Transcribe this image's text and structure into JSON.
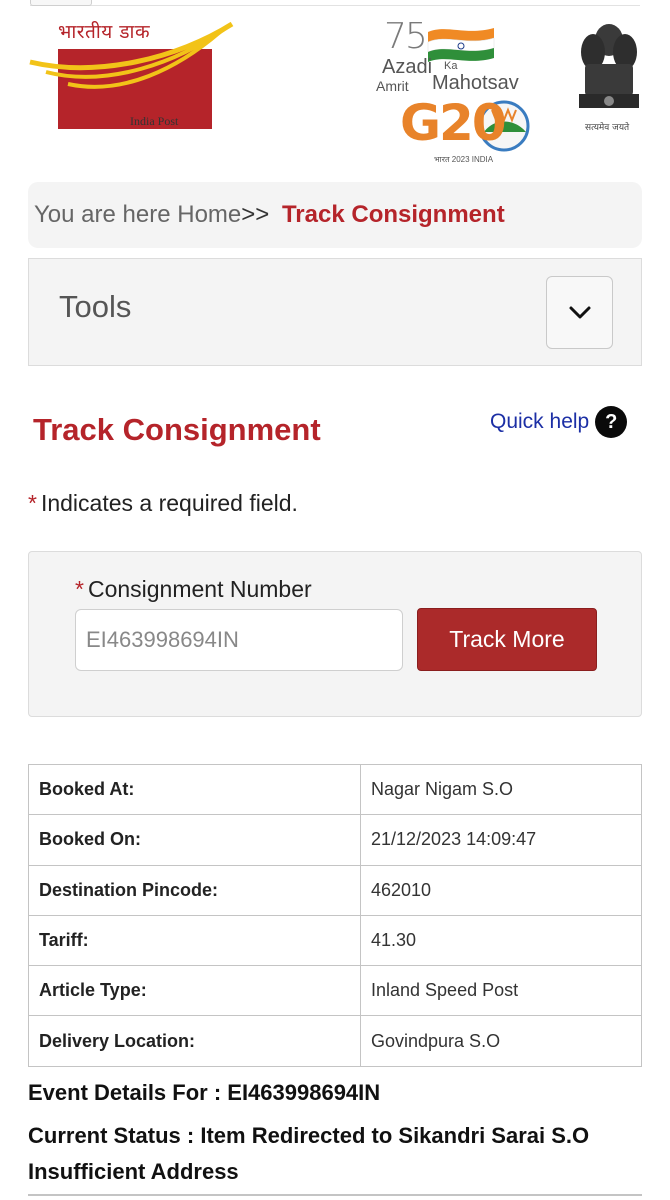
{
  "header": {
    "logo_hindi": "भारतीय डाक",
    "logo_english": "India Post",
    "g20_number": "75",
    "g20_azadi": "Azadi",
    "g20_ka": "Ka",
    "g20_amrit": "Amrit",
    "g20_mahotsav": "Mahotsav",
    "g20_mark": "G20",
    "g20_footer": "भारत 2023 INDIA",
    "emblem_text": "सत्यमेव जयते"
  },
  "breadcrumb": {
    "prefix": "You are here",
    "home": "Home",
    "separator": ">>",
    "current": "Track Consignment"
  },
  "tools": {
    "label": "Tools"
  },
  "page": {
    "title": "Track Consignment",
    "quick_help": "Quick help",
    "quick_help_icon": "?",
    "required_star": "*",
    "required_note": "Indicates a required field."
  },
  "form": {
    "label": "Consignment Number",
    "input_value": "EI463998694IN",
    "button_label": "Track More"
  },
  "details": [
    {
      "key": "Booked At:",
      "value": "Nagar Nigam S.O"
    },
    {
      "key": "Booked On:",
      "value": "21/12/2023 14:09:47"
    },
    {
      "key": "Destination Pincode:",
      "value": "462010"
    },
    {
      "key": "Tariff:",
      "value": "41.30"
    },
    {
      "key": "Article Type:",
      "value": "Inland Speed Post"
    },
    {
      "key": "Delivery Location:",
      "value": "Govindpura S.O"
    }
  ],
  "event": {
    "title": "Event Details For : EI463998694IN",
    "status": "Current Status : Item Redirected to Sikandri Sarai S.O Insufficient Address"
  },
  "colors": {
    "brand_red": "#b5242a",
    "button_red": "#ab2a2a",
    "link_blue": "#1c2fa5",
    "logo_yellow": "#f2c318"
  },
  "icons": {
    "tools_toggle": "chevron-down-icon",
    "quick_help": "question-circle-icon"
  }
}
